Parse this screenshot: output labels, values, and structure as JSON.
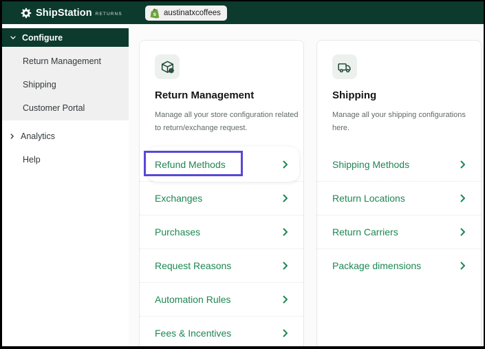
{
  "header": {
    "brand": "ShipStation",
    "brand_suffix": "RETURNS",
    "store_tab": "austinatxcoffees"
  },
  "sidebar": {
    "configure": {
      "label": "Configure",
      "expanded": true
    },
    "configure_items": [
      {
        "label": "Return Management"
      },
      {
        "label": "Shipping"
      },
      {
        "label": "Customer Portal"
      }
    ],
    "analytics": {
      "label": "Analytics",
      "expanded": false
    },
    "help": {
      "label": "Help"
    }
  },
  "cards": [
    {
      "title": "Return Management",
      "icon": "box-gear-icon",
      "description": "Manage all your store configuration related to return/exchange request.",
      "description_lines": [
        "Manage all your store configuration related",
        "to return/exchange request."
      ],
      "items": [
        {
          "label": "Refund Methods",
          "highlighted": true
        },
        {
          "label": "Exchanges"
        },
        {
          "label": "Purchases"
        },
        {
          "label": "Request Reasons"
        },
        {
          "label": "Automation Rules"
        },
        {
          "label": "Fees & Incentives"
        }
      ]
    },
    {
      "title": "Shipping",
      "icon": "truck-icon",
      "description": "Manage all your shipping configurations here.",
      "description_lines": [
        "Manage all your shipping configurations",
        "here."
      ],
      "items": [
        {
          "label": "Shipping Methods"
        },
        {
          "label": "Return Locations"
        },
        {
          "label": "Return Carriers"
        },
        {
          "label": "Package dimensions"
        }
      ]
    }
  ],
  "colors": {
    "header_green": "#0c3a2d",
    "link_green": "#1d8653",
    "highlight_purple": "#5847d6"
  }
}
